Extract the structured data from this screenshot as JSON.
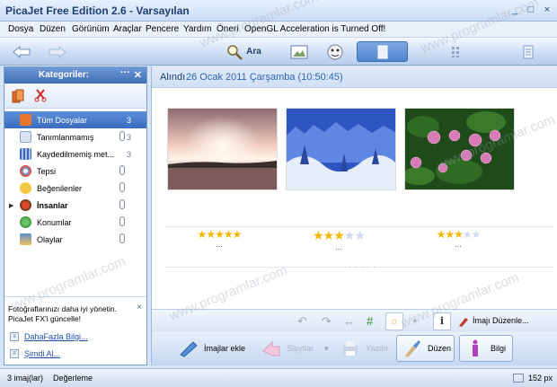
{
  "window": {
    "title": "PicaJet Free Edition 2.6 - Varsayılan",
    "controls": [
      "_",
      "□",
      "×"
    ]
  },
  "menu": {
    "items": [
      "Dosya",
      "Düzen",
      "Görünüm",
      "Araçlar",
      "Pencere",
      "Yardım",
      "Öneri",
      "OpenGL Acceleration is Turned Off!"
    ]
  },
  "toolbar": {
    "search_label": "Ara",
    "icons": [
      "back-arrow-icon",
      "forward-arrow-icon",
      "search-icon",
      "slideshow-icon",
      "faces-icon",
      "single-view-icon",
      "grid-view-icon",
      "list-view-icon"
    ]
  },
  "sidebar": {
    "title": "Kategoriler:",
    "menu_dots": "···",
    "close": "✕",
    "items": [
      {
        "label": "Tüm Dosyalar",
        "count": "3",
        "color": "#e8762c",
        "selected": true
      },
      {
        "label": "Tanımlanmamış",
        "count": "3",
        "color": "#d9e3f0",
        "clip": true
      },
      {
        "label": "Kaydedilmemiş met...",
        "count": "3",
        "color": "#3f66b5"
      },
      {
        "label": "Tepsi",
        "color": "#6a9ee0",
        "clip": true
      },
      {
        "label": "Beğenilenler",
        "color": "#f3c843",
        "clip": true
      },
      {
        "label": "İnsanlar",
        "color": "#7a3a1a",
        "clip": true,
        "bold": true,
        "expandable": true
      },
      {
        "label": "Konumlar",
        "color": "#3c9a3c",
        "clip": true
      },
      {
        "label": "Olaylar",
        "color": "#5b8fd4",
        "clip": true
      }
    ],
    "promo": {
      "message_line1": "Fotoğraflarınızı daha iyi yönetin.",
      "message_line2": "PicaJet FX'i güncelle!",
      "close": "×",
      "link1": "DahaFazla Bilgi...",
      "link2": "Şimdi Al..."
    }
  },
  "main": {
    "date_prefix": "Alındı",
    "date_value": "26 Ocak 2011 Çarşamba (10:50:45)",
    "photos": [
      {
        "ratings": 5,
        "stars_on": "★★★★★",
        "stars_off": "",
        "caption": "..."
      },
      {
        "ratings": 3,
        "stars_on": "★★★",
        "stars_off": "★★",
        "caption": "..."
      },
      {
        "ratings": 3.5,
        "stars_on": "★★★",
        "stars_off": "★★",
        "caption": "..."
      }
    ],
    "grip": "· · · · ·",
    "edit_bar": {
      "edit_label": "İmajı Düzenle..."
    },
    "bottom": {
      "add_images": "İmajlar ekle",
      "slideshow": "Slaytlar",
      "print": "Yazdır",
      "edit": "Düzen",
      "info": "Bilgi"
    }
  },
  "status": {
    "image_count": "3 imaj(lar)",
    "rating_label": "Değerleme",
    "zoom": "152 px"
  },
  "watermark": "www.programlar.com"
}
